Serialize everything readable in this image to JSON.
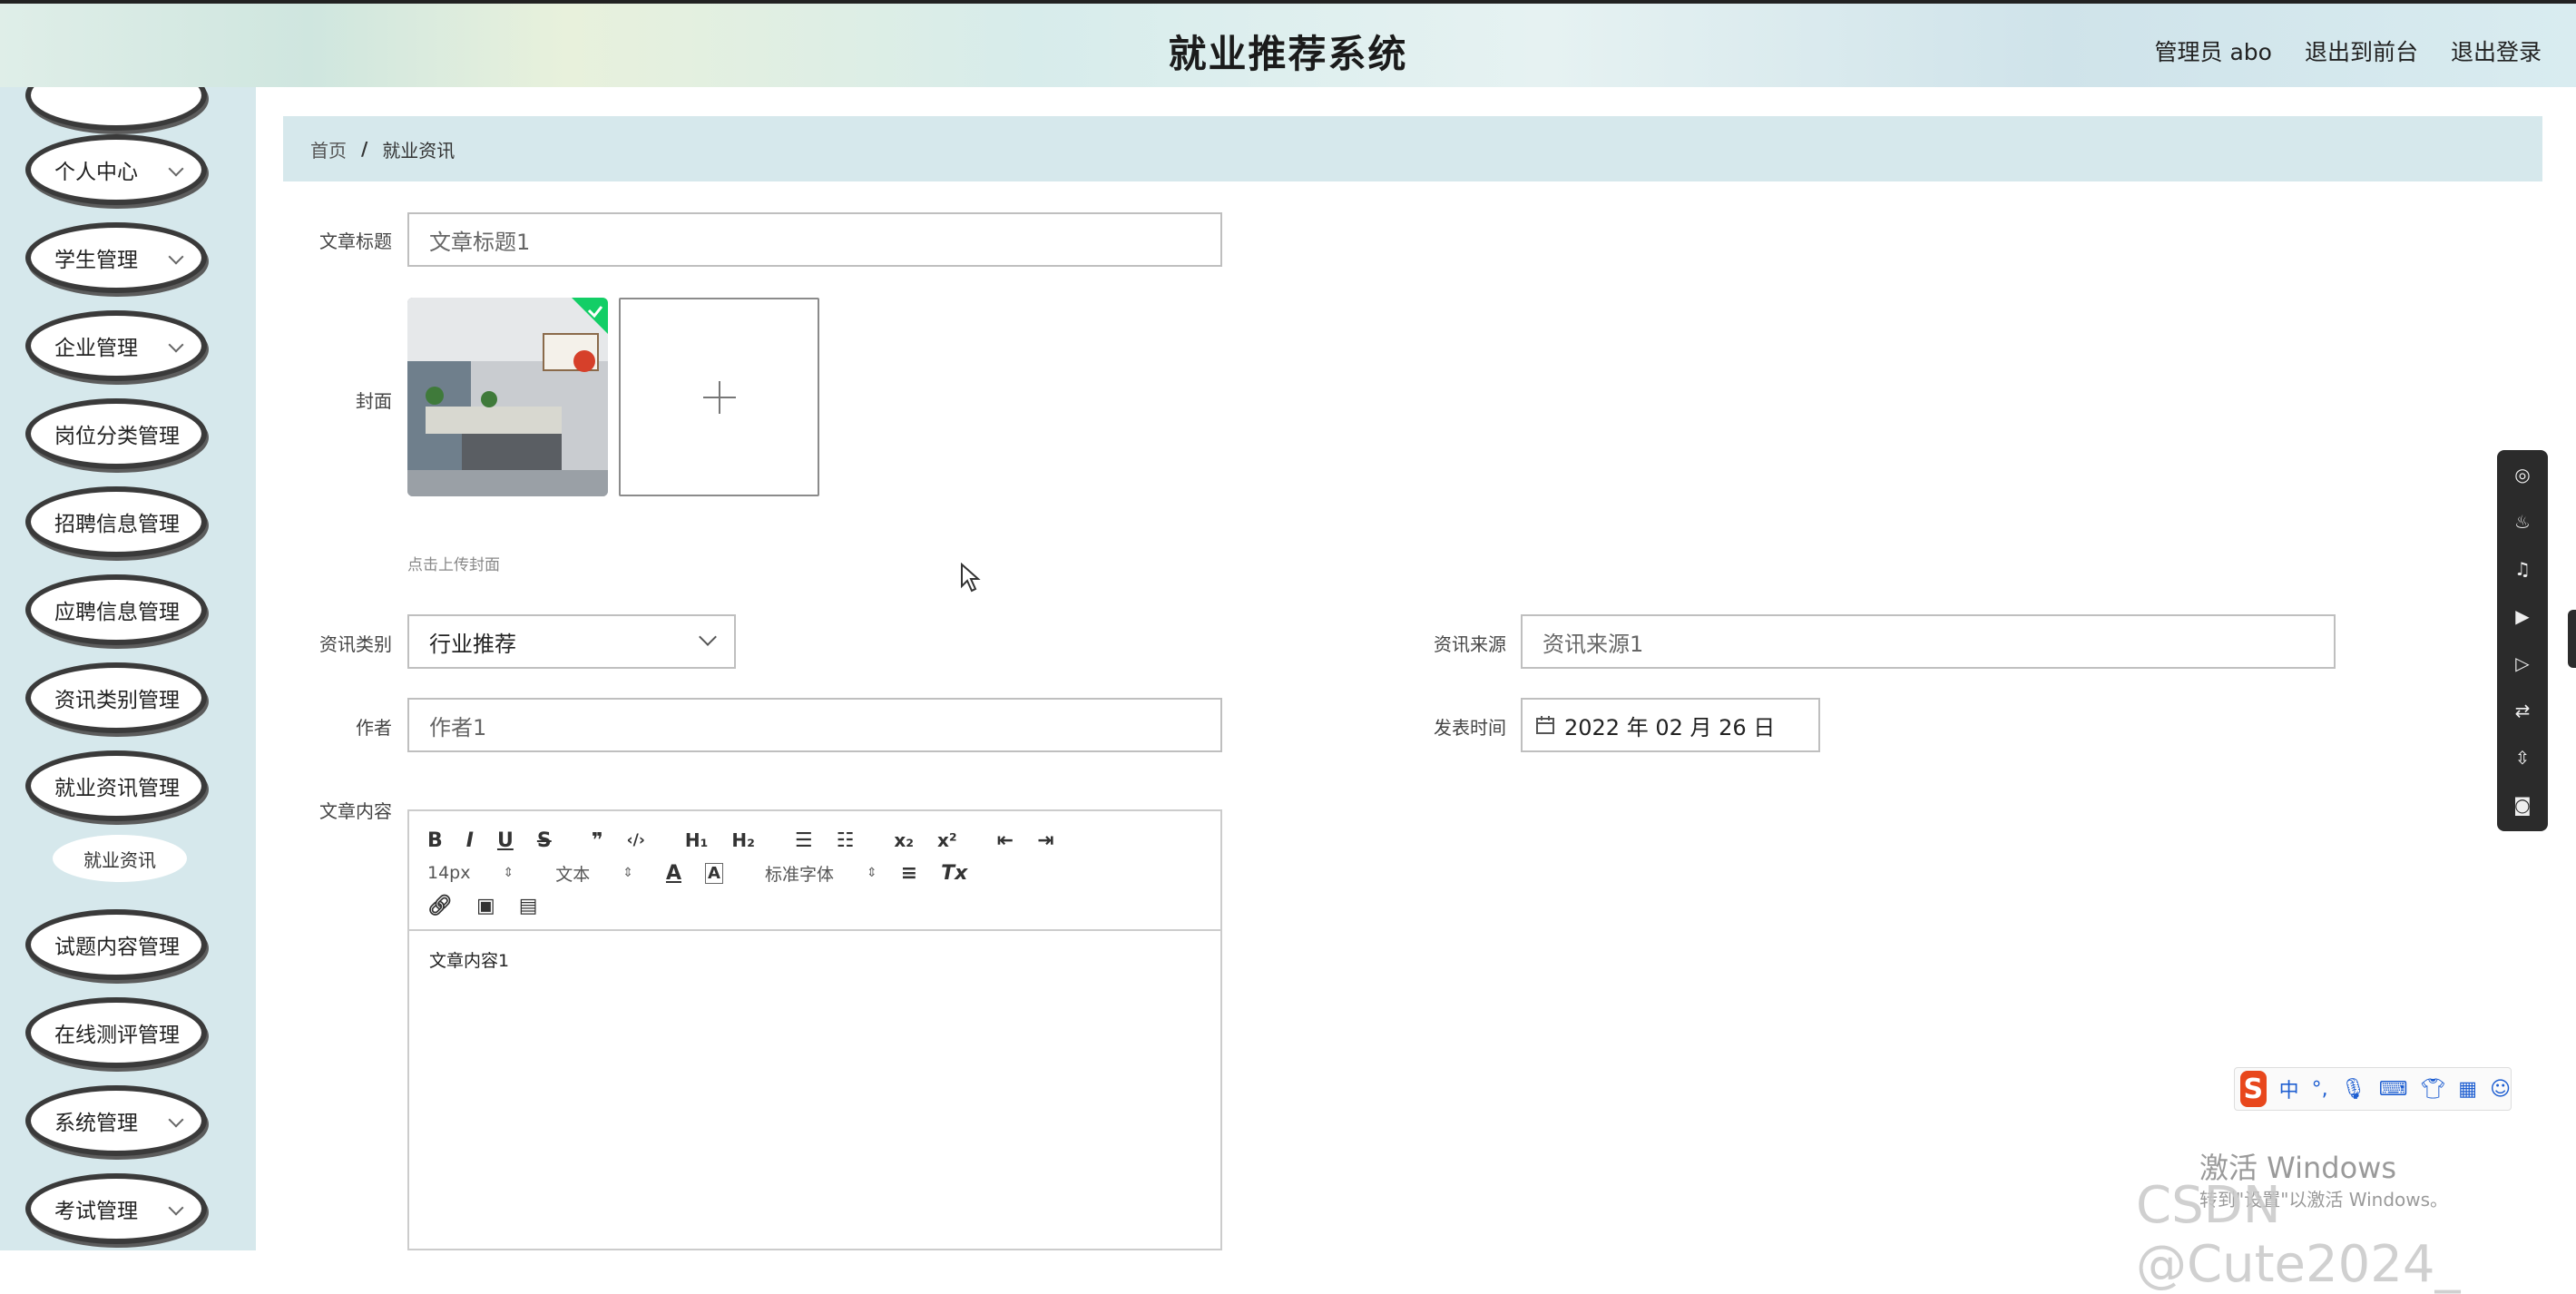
{
  "header": {
    "title": "就业推荐系统",
    "admin_label": "管理员 abo",
    "exit_front": "退出到前台",
    "logout": "退出登录"
  },
  "sidebar": {
    "items": [
      {
        "label": "个人中心",
        "chevron": true
      },
      {
        "label": "学生管理",
        "chevron": true
      },
      {
        "label": "企业管理",
        "chevron": true
      },
      {
        "label": "岗位分类管理",
        "chevron": false
      },
      {
        "label": "招聘信息管理",
        "chevron": false
      },
      {
        "label": "应聘信息管理",
        "chevron": false
      },
      {
        "label": "资讯类别管理",
        "chevron": false
      },
      {
        "label": "就业资讯管理",
        "chevron": false
      },
      {
        "label": "试题内容管理",
        "chevron": false
      },
      {
        "label": "在线测评管理",
        "chevron": false
      },
      {
        "label": "系统管理",
        "chevron": true
      },
      {
        "label": "考试管理",
        "chevron": true
      }
    ],
    "sub_item": "就业资讯"
  },
  "breadcrumb": {
    "home": "首页",
    "separator": "/",
    "current": "就业资讯"
  },
  "form": {
    "title_label": "文章标题",
    "title_value": "文章标题1",
    "cover_label": "封面",
    "cover_hint": "点击上传封面",
    "category_label": "资讯类别",
    "category_value": "行业推荐",
    "source_label": "资讯来源",
    "source_value": "资讯来源1",
    "author_label": "作者",
    "author_value": "作者1",
    "publish_label": "发表时间",
    "publish_value": "2022 年 02 月 26 日",
    "content_label": "文章内容",
    "content_value": "文章内容1"
  },
  "editor": {
    "font_size": "14px",
    "paragraph": "文本",
    "font_family": "标准字体"
  },
  "watermark": {
    "line1": "激活 Windows",
    "line2": "转到\"设置\"以激活 Windows。",
    "csdn": "CSDN @Cute2024_"
  },
  "colors": {
    "sidebar_bg": "#d6e8ec",
    "breadcrumb_bg": "#d6e8ec",
    "check_badge": "#13ce66"
  }
}
